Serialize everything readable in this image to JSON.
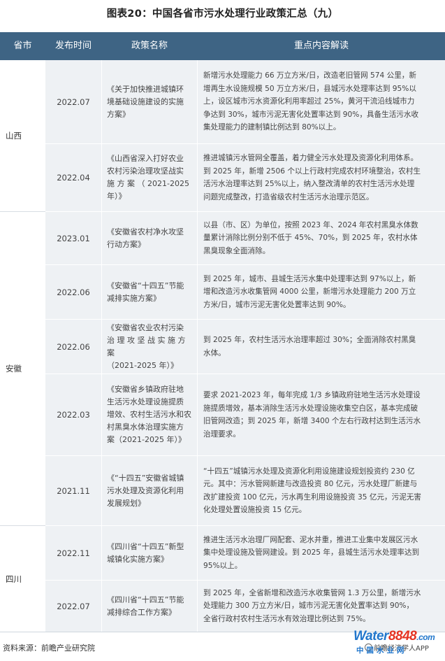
{
  "title": "图表20：中国各省市污水处理行业政策汇总（九）",
  "columns": {
    "province": "省市",
    "date": "发布时间",
    "policy": "政策名称",
    "content": "重点内容解读"
  },
  "provinces": [
    "山西",
    "安徽",
    "四川"
  ],
  "rows": [
    {
      "date": "2022.07",
      "policy": [
        "《关于加快推进城镇环",
        "境基础设施建设的实施",
        "方案》"
      ],
      "content": [
        "新增污水处理能力 66 万立方米/日，改造老旧管网 574 公里，新",
        "增再生水设施规模 50 万立方米/日，县城污水处理率达到 95%以",
        "上，设区城市污水资源化利用率超过 25%，黄河干流沿线城市力",
        "争达到 30%，城市污泥无害化处置率达到 90%，具备生活污水收",
        "集处理能力的建制镇比例达到 80%以上。"
      ]
    },
    {
      "date": "2022.04",
      "policy": [
        "《山西省深入打好农业",
        "农村污染治理攻坚战实",
        "施 方 案 （ 2021-2025",
        "年）》"
      ],
      "content": [
        "推进城镇污水管网全覆盖，着力健全污水处理及资源化利用体系。",
        "到 2025 年，新增 2506 个以上行政村完成农村环境整治，农村生",
        "活污水治理率达到 25%以上，纳入整改清单的农村生活污水处理",
        "问题完成整改，打造省级农村生活污水治理示范区。"
      ]
    },
    {
      "date": "2023.01",
      "policy": [
        "《安徽省农村净水攻坚",
        "行动方案》"
      ],
      "content": [
        "以县（市、区）为单位，按照 2023 年、2024 年农村黑臭水体数",
        "量累计消除比例分别不低于 45%、70%，到 2025 年，农村水体",
        "黑臭现象全面消除。"
      ]
    },
    {
      "date": "2022.06",
      "policy": [
        "《安徽省“十四五”节能",
        "减排实施方案》"
      ],
      "content": [
        "到 2025 年，城市、县城生活污水集中处理率达到 97%以上，新",
        "增和改造污水收集管网 4000 公里，新增污水处理能力 200 万立",
        "方米/日，城市污泥无害化处置率达到 90%。"
      ]
    },
    {
      "date": "2022.06",
      "policy": [
        "《安徽省农业农村污染",
        "治 理 攻 坚 战 实 施 方 案",
        "（2021-2025 年）》"
      ],
      "content": [
        "到 2025 年，农村生活污水治理率超过 30%；全面消除农村黑臭",
        "水体。"
      ]
    },
    {
      "date": "2022.03",
      "policy": [
        "《安徽省乡镇政府驻地",
        "生活污水处理设施提质",
        "增效、农村生活污水和农",
        "村黑臭水体治理实施方",
        "案（2021-2025 年）》"
      ],
      "content": [
        "要求 2021-2023 年，每年完成 1/3 乡镇政府驻地生活污水处理设",
        "施提质增效，基本消除生活污水处理设施收集空白区，基本完成破",
        "旧管网改造；到 2025 年，新增 3400 个左右行政村达到生活污水",
        "治理要求。"
      ]
    },
    {
      "date": "2021.11",
      "policy": [
        "《“十四五”安徽省城镇",
        "污水处理及资源化利用",
        "发展规划》"
      ],
      "content": [
        "“十四五”城镇污水处理及资源化利用设施建设规划投资约 230 亿",
        "元。其中：污水管网新建与改造投资 80 亿元，污水处理厂新建与",
        "改扩建投资 100 亿元，污水再生利用设施投资 35 亿元，污泥无害",
        "化处理处置设施投资 15 亿元。"
      ]
    },
    {
      "date": "2022.11",
      "policy": [
        "《四川省“十四五”新型",
        "城镇化实施方案》"
      ],
      "content": [
        "推进生活污水治理厂网配套、泥水并重，推进工业集中发展区污水",
        "集中处理设施及管网建设。到 2025 年，县城生活污水处理率达到",
        "95%以上。"
      ]
    },
    {
      "date": "2022.07",
      "policy": [
        "《四川省“十四五”节能",
        "减排综合工作方案》"
      ],
      "content": [
        "到 2025 年，全省新增和改造污水收集管网 1.3 万公里，新增污水",
        "处理能力 300 万立方米/日，城市污泥无害化处置率达到 90%，",
        "全省行政村农村生活污水有效治理比例达到 75%。"
      ]
    }
  ],
  "footer": {
    "source": "资料来源：前瞻产业研究院",
    "watermark_logo_main": "Water",
    "watermark_logo_num": "8848",
    "watermark_logo_tld": ".com",
    "watermark_sub": "中国水业网",
    "watermark_app": "前瞻经济学人APP"
  }
}
